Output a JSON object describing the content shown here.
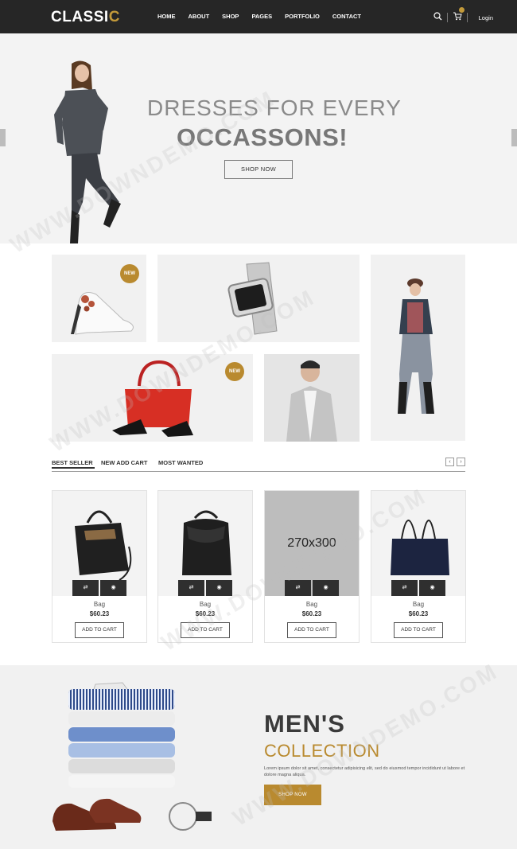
{
  "header": {
    "logo_main": "CLASSI",
    "logo_accent": "C",
    "nav": [
      "HOME",
      "ABOUT",
      "SHOP",
      "PAGES",
      "PORTFOLIO",
      "CONTACT"
    ],
    "login_label": "Login"
  },
  "hero": {
    "title_line1": "DRESSES FOR EVERY",
    "title_line2": "OCCASSONS!",
    "button_label": "SHOP NOW"
  },
  "categories": {
    "badge_new": "NEW"
  },
  "tabs": {
    "items": [
      "BEST SELLER",
      "NEW ADD CART",
      "MOST WANTED"
    ],
    "prev_icon": "‹",
    "next_icon": "›"
  },
  "products": [
    {
      "name": "Bag",
      "price": "$60.23",
      "button": "ADD TO CART"
    },
    {
      "name": "Bag",
      "price": "$60.23",
      "button": "ADD TO CART"
    },
    {
      "name": "Bag",
      "price": "$60.23",
      "button": "ADD TO CART",
      "placeholder": "270x300"
    },
    {
      "name": "Bag",
      "price": "$60.23",
      "button": "ADD TO CART"
    }
  ],
  "men_collection": {
    "title_line1": "MEN'S",
    "title_line2": "COLLECTION",
    "description": "Lorem ipsum dolor sit amet, consectetur adipisicing elit, sed do eiusmod tempor incididunt ut labore et dolore magna aliqua.",
    "button_label": "SHOP NOW"
  },
  "watermark": "WWW.DOWNDEMO.COM",
  "colors": {
    "header_bg": "#262626",
    "accent": "#b98a2f",
    "hero_bg": "#f3f3f3",
    "action_button": "#2f2f2f"
  }
}
